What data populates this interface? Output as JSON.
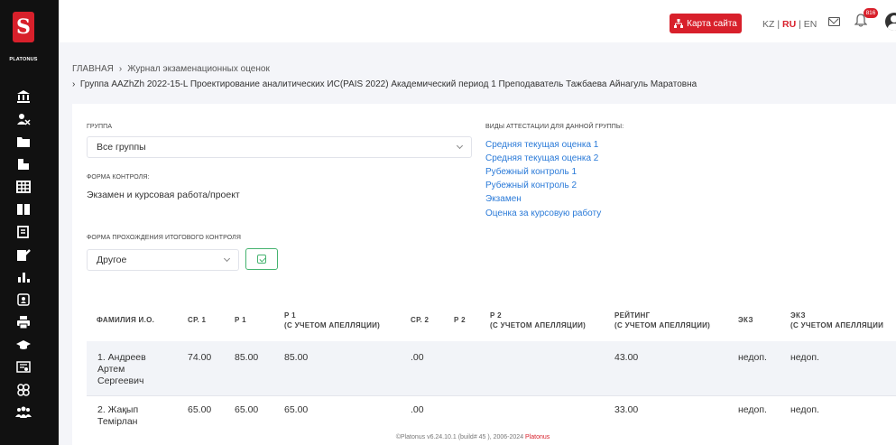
{
  "sidebar": {
    "logo_letter": "S",
    "logo_text": "PLATONUS",
    "icons": [
      "bank-icon",
      "users-icon",
      "folder-icon",
      "documents-icon",
      "grid-icon",
      "book-icon",
      "forms-icon",
      "edit-icon",
      "bar-chart-icon",
      "id-card-icon",
      "printer-icon",
      "graduation-cap-icon",
      "certificate-icon",
      "group-icon",
      "people-icon"
    ]
  },
  "topbar": {
    "sitemap_label": "Карта сайта",
    "languages": [
      "KZ",
      "RU",
      "EN"
    ],
    "active_language": "RU",
    "notification_count": "816"
  },
  "breadcrumb": {
    "home": "ГЛАВНАЯ",
    "current": "Журнал экзаменационных оценок",
    "line2": "Группа AAZhZh 2022-15-L Проектирование аналитических ИС(PAIS 2022) Академический период 1  Преподаватель Тажбаева Айнагуль Маратовна"
  },
  "form": {
    "group_label": "ГРУППА",
    "group_value": "Все группы",
    "control_form_label": "ФОРМА КОНТРОЛЯ:",
    "control_form_value": "Экзамен и курсовая работа/проект",
    "final_control_label": "ФОРМА ПРОХОЖДЕНИЯ ИТОГОВОГО КОНТРОЛЯ",
    "final_control_value": "Другое",
    "attestation_label": "ВИДЫ АТТЕСТАЦИИ ДЛЯ ДАННОЙ ГРУППЫ:",
    "attestation_links": [
      "Средняя текущая оценка 1",
      "Средняя текущая оценка 2",
      "Рубежный контроль 1",
      "Рубежный контроль 2",
      "Экзамен",
      "Оценка за курсовую работу"
    ]
  },
  "table": {
    "headers": {
      "name": "ФАМИЛИЯ И.О.",
      "avg1": "СР. 1",
      "r1": "Р 1",
      "r1_appeal_1": "Р 1",
      "r1_appeal_2": "(С УЧЕТОМ АПЕЛЛЯЦИИ)",
      "avg2": "СР. 2",
      "r2": "Р 2",
      "r2_appeal_1": "Р 2",
      "r2_appeal_2": "(С УЧЕТОМ АПЕЛЛЯЦИИ)",
      "rating_1": "РЕЙТИНГ",
      "rating_2": "(С УЧЕТОМ АПЕЛЛЯЦИИ)",
      "exam": "ЭКЗ",
      "exam_appeal_1": "ЭКЗ",
      "exam_appeal_2": "(С УЧЕТОМ АПЕЛЛЯЦИИ"
    },
    "rows": [
      {
        "name_1": "1. Андреев",
        "name_2": "Артем",
        "name_3": "Сергеевич",
        "avg1": "74.00",
        "r1": "85.00",
        "r1_appeal": "85.00",
        "avg2": ".00",
        "rating": "43.00",
        "exam": "недоп.",
        "exam_appeal": "недоп."
      },
      {
        "name_1": "2. Жақып",
        "name_2": "Темірлан",
        "avg1": "65.00",
        "r1": "65.00",
        "r1_appeal": "65.00",
        "avg2": ".00",
        "rating": "33.00",
        "exam": "недоп.",
        "exam_appeal": "недоп."
      }
    ]
  },
  "footer": {
    "text": "©Platonus v6.24.10.1 (build# 45 ), 2006-2024 ",
    "brand": "Platonus"
  }
}
